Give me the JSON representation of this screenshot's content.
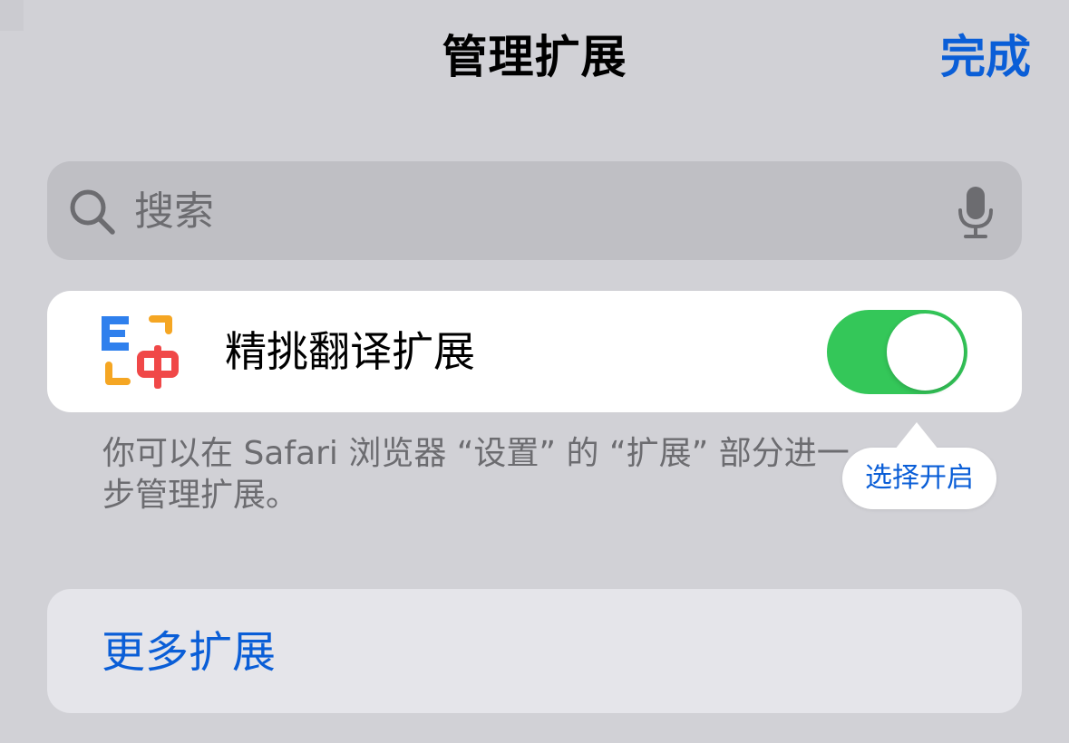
{
  "header": {
    "title": "管理扩展",
    "done_label": "完成"
  },
  "search": {
    "placeholder": "搜索",
    "value": "",
    "search_icon": "magnifying-glass",
    "mic_icon": "microphone"
  },
  "extension": {
    "name": "精挑翻译扩展",
    "icon": "app-icon-E-中",
    "enabled": true
  },
  "footnote": {
    "text": "你可以在 Safari 浏览器 “设置” 的 “扩展” 部分进一步管理扩展。"
  },
  "tooltip": {
    "text": "选择开启"
  },
  "more_extensions": {
    "label": "更多扩展"
  },
  "colors": {
    "accent": "#0a5ed7",
    "toggle_on": "#34c759",
    "background": "#d1d1d6",
    "icon_blue": "#2f80ed",
    "icon_orange": "#f5a623",
    "icon_red": "#f04848"
  }
}
